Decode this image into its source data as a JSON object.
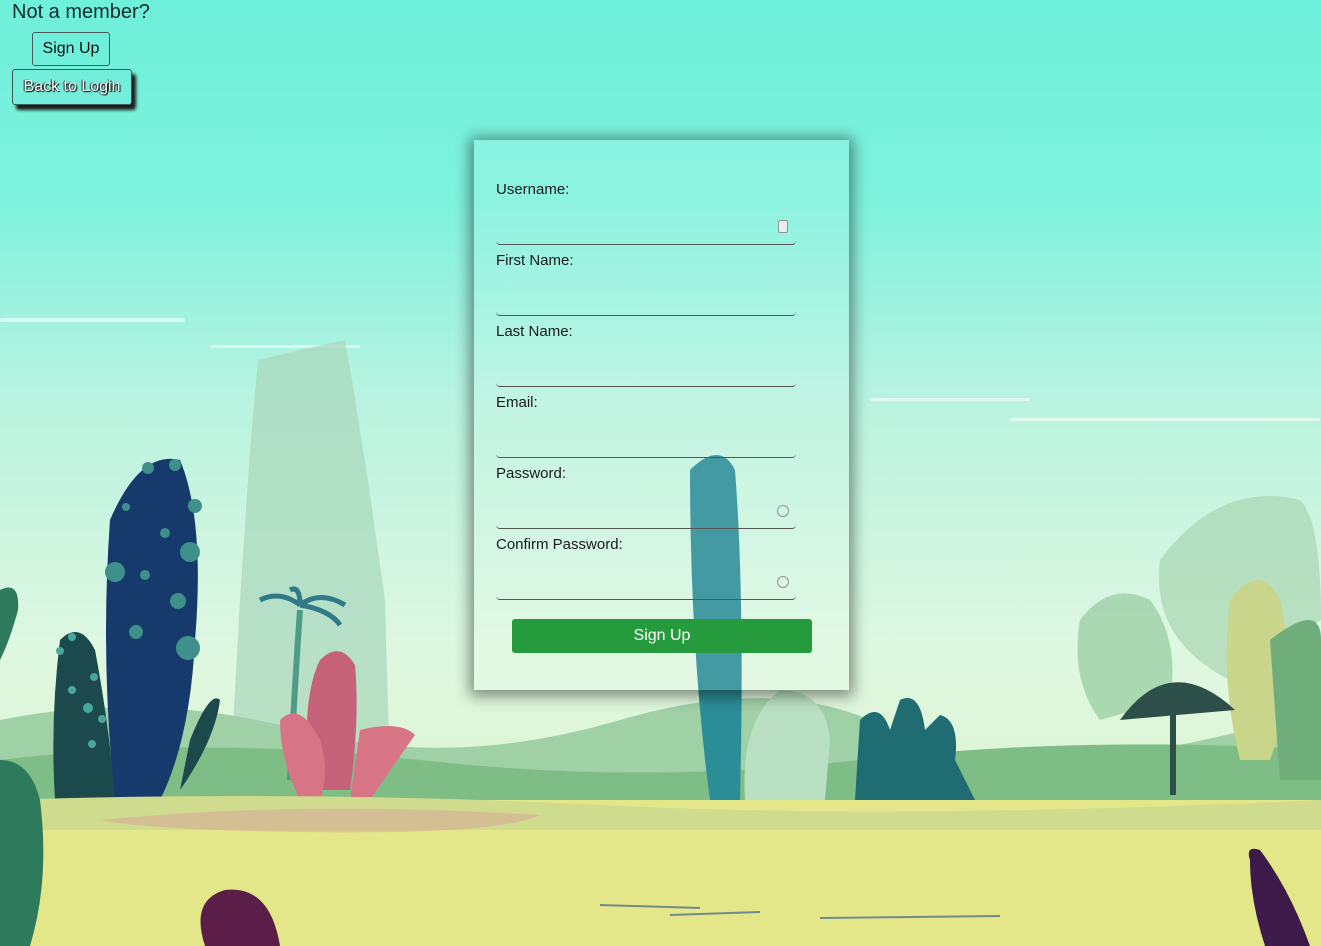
{
  "page": {
    "heading": "Not a member?",
    "sign_up_label": "Sign Up",
    "back_to_login_label": "Back to Login"
  },
  "form": {
    "fields": [
      {
        "label": "Username:",
        "value": "",
        "icon": "contact-card-icon"
      },
      {
        "label": "First Name:",
        "value": ""
      },
      {
        "label": "Last Name:",
        "value": ""
      },
      {
        "label": "Email:",
        "value": ""
      },
      {
        "label": "Password:",
        "value": "",
        "icon": "key-icon"
      },
      {
        "label": "Confirm Password:",
        "value": "",
        "icon": "key-icon"
      }
    ],
    "submit_label": "Sign Up"
  },
  "colors": {
    "sky": "#6ef0da",
    "submit": "#259b3e",
    "accent_button": "#73eedb"
  }
}
